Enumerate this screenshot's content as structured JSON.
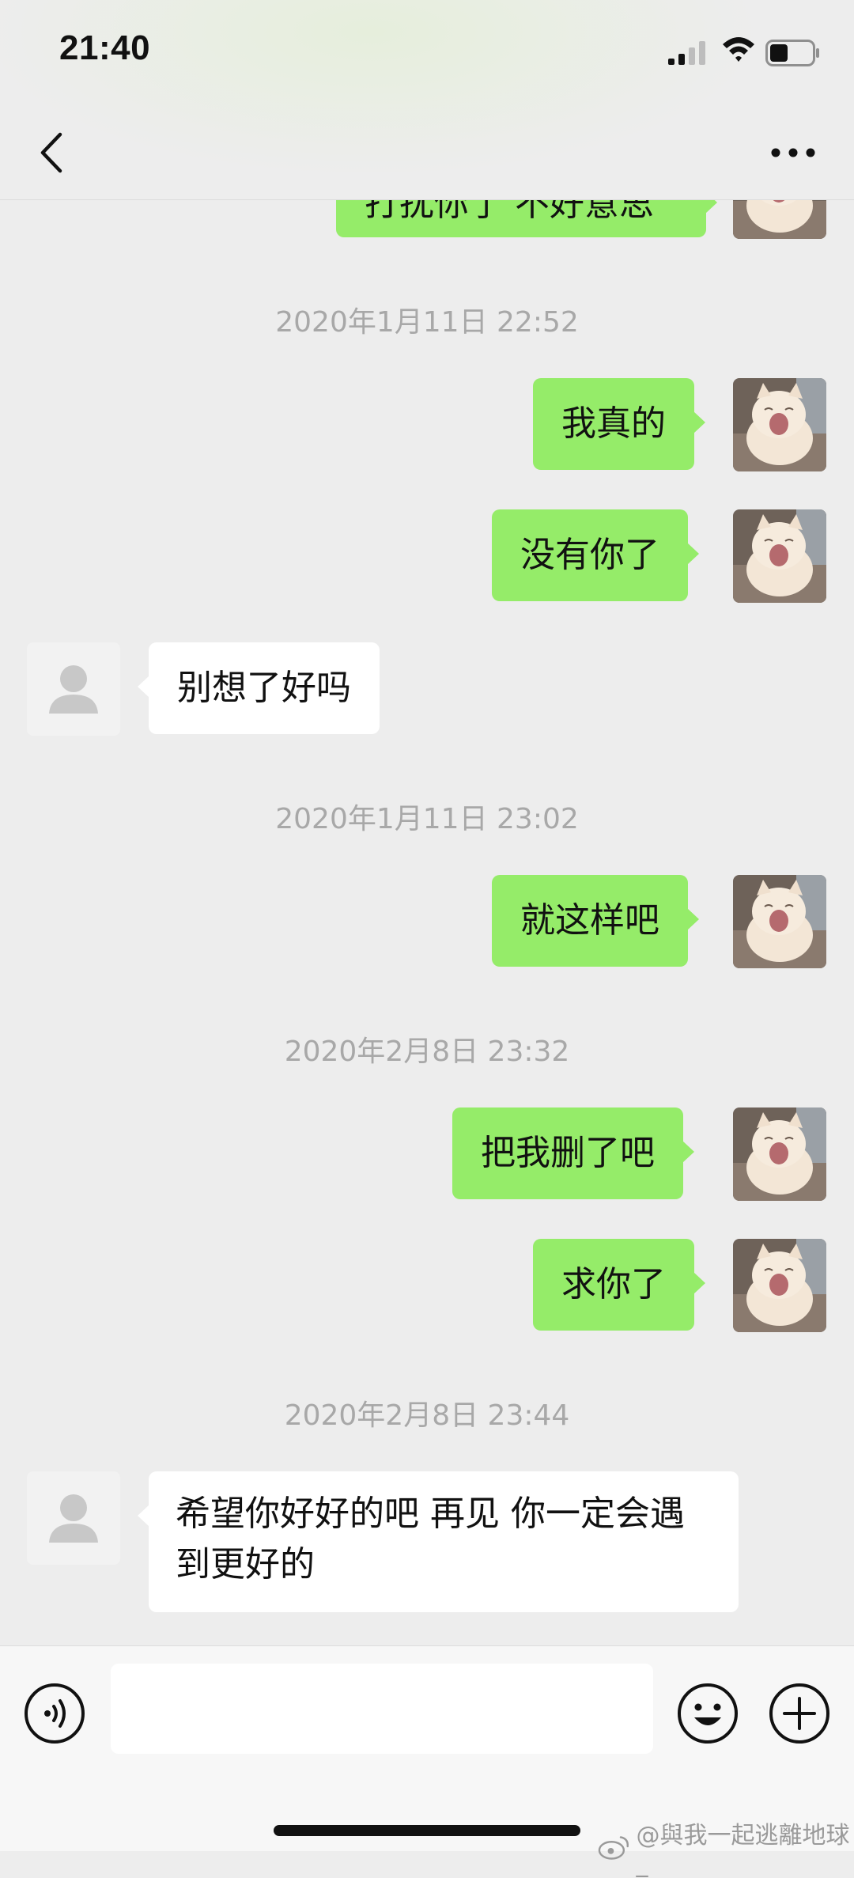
{
  "status_bar": {
    "time": "21:40"
  },
  "nav": {
    "back_icon": "chevron-left-icon",
    "more_icon": "more-dots-icon"
  },
  "chat": {
    "top_partial_message": "打扰你了 不好意思",
    "items": [
      {
        "type": "timestamp",
        "text": "2020年1月11日 22:52"
      },
      {
        "type": "message",
        "from": "me",
        "text": "我真的"
      },
      {
        "type": "message",
        "from": "me",
        "text": "没有你了"
      },
      {
        "type": "message",
        "from": "them",
        "text": "别想了好吗"
      },
      {
        "type": "timestamp",
        "text": "2020年1月11日 23:02"
      },
      {
        "type": "message",
        "from": "me",
        "text": "就这样吧"
      },
      {
        "type": "timestamp",
        "text": "2020年2月8日 23:32"
      },
      {
        "type": "message",
        "from": "me",
        "text": "把我删了吧"
      },
      {
        "type": "message",
        "from": "me",
        "text": "求你了"
      },
      {
        "type": "timestamp",
        "text": "2020年2月8日 23:44"
      },
      {
        "type": "message",
        "from": "them",
        "text": "希望你好好的吧 再见 你一定会遇到更好的"
      }
    ]
  },
  "input_bar": {
    "message_value": "",
    "voice_icon": "voice-icon",
    "emoji_icon": "emoji-icon",
    "add_icon": "plus-circle-icon"
  },
  "watermark": {
    "text": "@與我一起逃離地球_"
  },
  "colors": {
    "my_bubble": "#95EC69",
    "their_bubble": "#FFFFFF",
    "background": "#EDEDED",
    "timestamp_text": "#A8A8A8"
  }
}
